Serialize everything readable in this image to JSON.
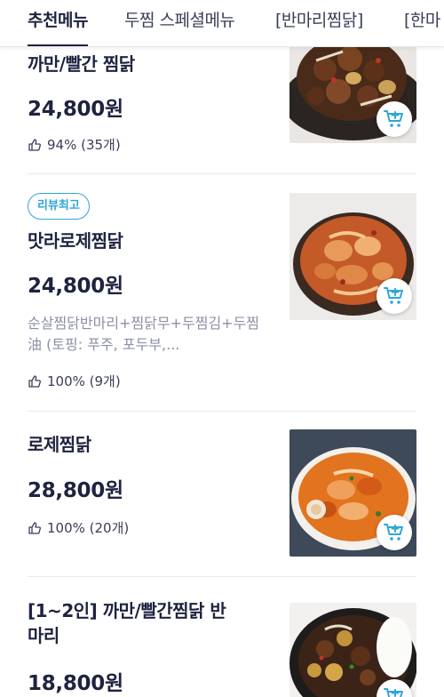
{
  "tabs": [
    {
      "label": "추천메뉴",
      "active": true
    },
    {
      "label": "두찜 스페셜메뉴",
      "active": false
    },
    {
      "label": "[반마리찜닭]",
      "active": false
    },
    {
      "label": "[한마",
      "active": false
    }
  ],
  "menu": [
    {
      "title": "까만/빨간 찜닭",
      "price": "24,800원",
      "rating": "94% (35개)",
      "badge": null,
      "description": null,
      "image": "dark-braised-chicken-photo"
    },
    {
      "title": "맛라로제찜닭",
      "price": "24,800원",
      "rating": "100% (9개)",
      "badge": "리뷰최고",
      "description": "순살찜닭반마리+찜닭무+두찜김+두찜油 (토핑: 푸주, 포두부,...",
      "image": "mala-rose-chicken-photo"
    },
    {
      "title": "로제찜닭",
      "price": "28,800원",
      "rating": "100% (20개)",
      "badge": null,
      "description": null,
      "image": "rose-chicken-photo"
    },
    {
      "title": "[1~2인] 까만/빨간찜닭 반마리",
      "price": "18,800원",
      "rating": null,
      "badge": null,
      "description": null,
      "image": "half-chicken-pot-photo"
    }
  ],
  "colors": {
    "text": "#1f2340",
    "subtext": "#8c90a6",
    "accent": "#2fa6d6",
    "divider": "#e9e9ee"
  },
  "icons": {
    "rating": "thumbs-up-icon",
    "cart": "add-to-cart-icon"
  }
}
